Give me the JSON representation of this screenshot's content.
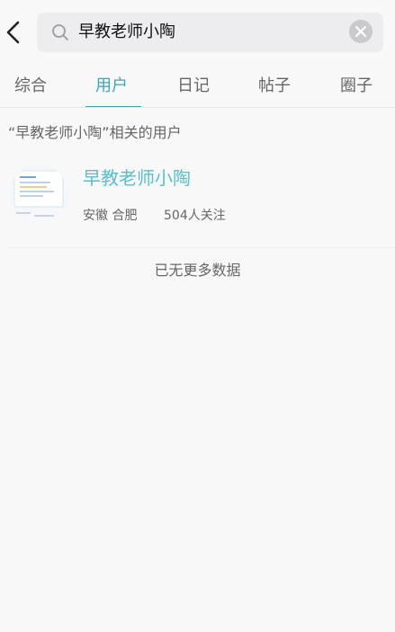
{
  "search": {
    "query": "早教老师小陶"
  },
  "tabs": [
    {
      "label": "综合"
    },
    {
      "label": "用户"
    },
    {
      "label": "日记"
    },
    {
      "label": "帖子"
    },
    {
      "label": "圈子"
    }
  ],
  "section": {
    "title": "“早教老师小陶”相关的用户"
  },
  "user": {
    "name": "早教老师小陶",
    "location": "安徽 合肥",
    "followers": "504人关注"
  },
  "footer": {
    "no_more": "已无更多数据"
  },
  "colors": {
    "accent": "#3aa8b5",
    "name": "#58bfc9"
  }
}
